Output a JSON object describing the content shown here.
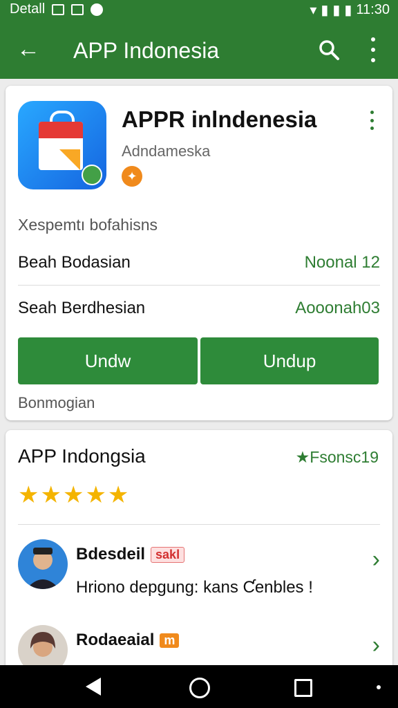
{
  "statusbar": {
    "carrier": "Detall",
    "time": "11:30"
  },
  "appbar": {
    "title": "APP Indonesia"
  },
  "app_card": {
    "name": "APPR inlndenesia",
    "developer": "Adndameska",
    "subtitle": "Xespemtı bofahisns",
    "rows": [
      {
        "label": "Beah Bodasian",
        "value": "Noonal 12"
      },
      {
        "label": "Seah Berdhesian",
        "value": "Aooonah03"
      }
    ],
    "buttons": [
      "Undw",
      "Undup"
    ],
    "footnote": "Bonmogian"
  },
  "review_card": {
    "title": "APP Indongsia",
    "right_text": "★Fsonsc19",
    "rating": 4.5,
    "stars": "★★★★★",
    "reviews": [
      {
        "name": "Bdesdeil",
        "tag": "sakl",
        "text": "Hriono depgung: kans Ƈenbles !"
      },
      {
        "name": "Rodaeaial",
        "tag": "m",
        "text": ""
      }
    ]
  },
  "colors": {
    "primary": "#2e7d32",
    "button": "#2e8b3a",
    "star": "#f4b400"
  }
}
